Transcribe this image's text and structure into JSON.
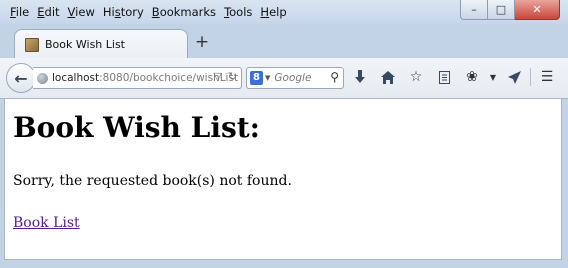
{
  "menu": {
    "items": [
      {
        "accel": "F",
        "rest": "ile"
      },
      {
        "accel": "E",
        "rest": "dit"
      },
      {
        "accel": "V",
        "rest": "iew"
      },
      {
        "accel": "s",
        "pre": "Hi",
        "rest": "tory"
      },
      {
        "accel": "B",
        "rest": "ookmarks"
      },
      {
        "accel": "T",
        "rest": "ools"
      },
      {
        "accel": "H",
        "rest": "elp"
      }
    ]
  },
  "window_controls": {
    "minimize": "–",
    "maximize": "□",
    "close": "✕"
  },
  "tab": {
    "title": "Book Wish List",
    "new_tab": "+"
  },
  "nav": {
    "url_host": "localhost",
    "url_rest": ":8080/bookchoice/wishList",
    "search_placeholder": "Google",
    "search_engine_letter": "8"
  },
  "page": {
    "heading": "Book Wish List:",
    "message": "Sorry, the requested book(s) not found.",
    "link_text": "Book List"
  }
}
